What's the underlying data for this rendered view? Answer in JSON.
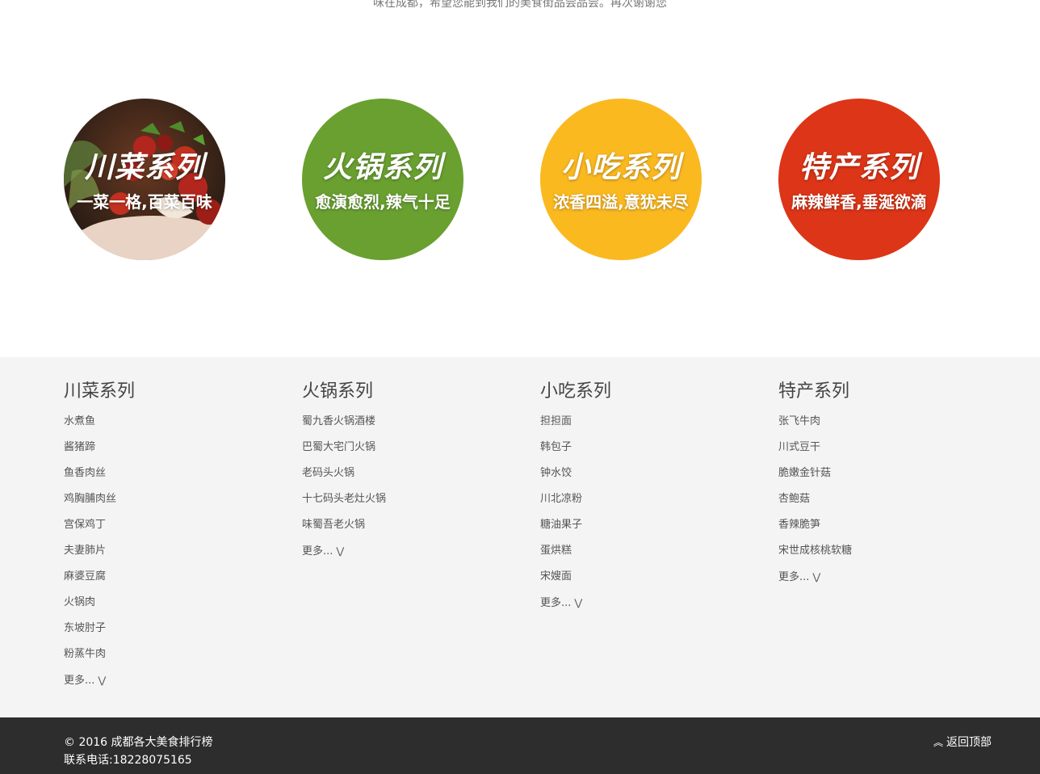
{
  "intro": {
    "text": "味在成都，希望您能到我们的美食街品尝品尝。再次谢谢您"
  },
  "categories": [
    {
      "title": "川菜系列",
      "subtitle": "一菜一格,百菜百味",
      "color": "#5a2a1a"
    },
    {
      "title": "火锅系列",
      "subtitle": "愈演愈烈,辣气十足",
      "color": "#69a030"
    },
    {
      "title": "小吃系列",
      "subtitle": "浓香四溢,意犹未尽",
      "color": "#fbb920"
    },
    {
      "title": "特产系列",
      "subtitle": "麻辣鲜香,垂涎欲滴",
      "color": "#dc3517"
    }
  ],
  "columns": [
    {
      "heading": "川菜系列",
      "items": [
        "水煮鱼",
        "酱猪蹄",
        "鱼香肉丝",
        "鸡胸脯肉丝",
        "宫保鸡丁",
        "夫妻肺片",
        "麻婆豆腐",
        "火锅肉",
        "东坡肘子",
        "粉蒸牛肉"
      ],
      "more": "更多..."
    },
    {
      "heading": "火锅系列",
      "items": [
        "蜀九香火锅酒楼",
        "巴蜀大宅门火锅",
        "老码头火锅",
        "十七码头老灶火锅",
        "味蜀吾老火锅"
      ],
      "more": "更多..."
    },
    {
      "heading": "小吃系列",
      "items": [
        "担担面",
        "韩包子",
        "钟水饺",
        "川北凉粉",
        "糖油果子",
        "蛋烘糕",
        "宋嫂面"
      ],
      "more": "更多..."
    },
    {
      "heading": "特产系列",
      "items": [
        "张飞牛肉",
        "川式豆干",
        "脆嫩金针菇",
        "杏鲍菇",
        "香辣脆笋",
        "宋世成核桃软糖"
      ],
      "more": "更多..."
    }
  ],
  "footer": {
    "copyright": "© 2016 成都各大美食排行榜",
    "phone": "联系电话:18228075165",
    "back_to_top": "返回顶部"
  }
}
